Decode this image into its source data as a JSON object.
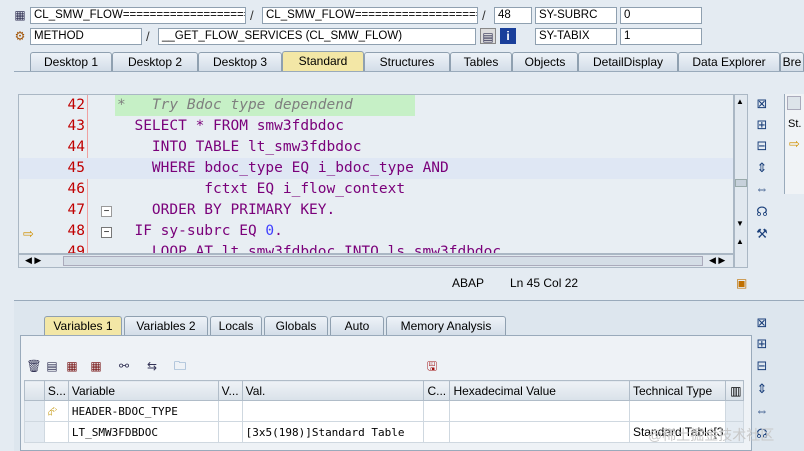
{
  "header": {
    "program_field": "CL_SMW_FLOW===================",
    "include_field": "CL_SMW_FLOW===================",
    "line_number": "48",
    "var1_name": "SY-SUBRC",
    "var1_value": "0",
    "type_field": "METHOD",
    "method_field": "__GET_FLOW_SERVICES (CL_SMW_FLOW)",
    "var2_name": "SY-TABIX",
    "var2_value": "1",
    "separator": "/"
  },
  "main_tabs": [
    "Desktop 1",
    "Desktop 2",
    "Desktop 3",
    "Standard",
    "Structures",
    "Tables",
    "Objects",
    "DetailDisplay",
    "Data Explorer",
    "Bre"
  ],
  "active_main_tab": "Standard",
  "editor": {
    "lines": [
      {
        "no": "42",
        "parts": [
          {
            "t": "*   Try Bdoc type dependend",
            "c": "cm"
          }
        ]
      },
      {
        "no": "43",
        "parts": [
          {
            "t": "  SELECT * FROM ",
            "c": "kw"
          },
          {
            "t": "smw3fdbdoc",
            "c": "kw"
          }
        ]
      },
      {
        "no": "44",
        "parts": [
          {
            "t": "    INTO TABLE ",
            "c": "kw"
          },
          {
            "t": "lt_smw3fdbdoc",
            "c": "kw"
          }
        ]
      },
      {
        "no": "45",
        "parts": [
          {
            "t": "    WHERE ",
            "c": "kw"
          },
          {
            "t": "bdoc_type",
            "c": "kw"
          },
          {
            "t": " EQ ",
            "c": "kw"
          },
          {
            "t": "i_bdoc_type",
            "c": "kw"
          },
          {
            "t": " AND",
            "c": "kw"
          }
        ]
      },
      {
        "no": "46",
        "parts": [
          {
            "t": "          fctxt EQ i_flow_context",
            "c": "kw"
          }
        ]
      },
      {
        "no": "47",
        "parts": [
          {
            "t": "    ORDER BY PRIMARY KEY.",
            "c": "kw"
          }
        ]
      },
      {
        "no": "48",
        "parts": [
          {
            "t": "  IF sy-subrc EQ ",
            "c": "kw"
          },
          {
            "t": "0",
            "c": "nm"
          },
          {
            "t": ".",
            "c": "kw"
          }
        ]
      },
      {
        "no": "49",
        "parts": [
          {
            "t": "    LOOP AT lt_smw3fdbdoc INTO ls_smw3fdbdoc",
            "c": "kw"
          }
        ]
      }
    ],
    "current_line": "48",
    "cursor_line": "45",
    "lang": "ABAP",
    "position": "Ln  45 Col  22"
  },
  "var_tabs": [
    "Variables 1",
    "Variables 2",
    "Locals",
    "Globals",
    "Auto",
    "Memory Analysis"
  ],
  "active_var_tab": "Variables 1",
  "var_table": {
    "columns": [
      "S...",
      "Variable",
      "V...",
      "Val.",
      "C...",
      "Hexadecimal Value",
      "Technical Type"
    ],
    "rows": [
      {
        "s": "",
        "variable": "HEADER-BDOC_TYPE",
        "v": "",
        "val": "",
        "c": "",
        "hex": "",
        "type": ""
      },
      {
        "s": "",
        "variable": "LT_SMW3FDBDOC",
        "v": "",
        "val": "[3x5(198)]Standard Table",
        "c": "",
        "hex": "",
        "type": "Standard Table[3"
      }
    ]
  },
  "watermark": "@稀土掘金技术社区",
  "colors": {
    "active_tab": "#f3e7a6",
    "keyword": "#7a007a",
    "line_number": "#c00000",
    "comment": "#7f7f7f",
    "number": "#4040ff"
  }
}
